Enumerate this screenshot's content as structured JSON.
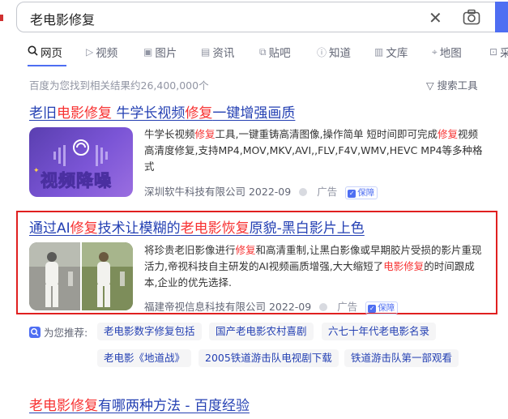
{
  "search": {
    "query": "老电影修复"
  },
  "tabs": [
    {
      "label": "网页",
      "icon": "search-icon"
    },
    {
      "label": "视频",
      "icon": "video-icon"
    },
    {
      "label": "图片",
      "icon": "image-icon"
    },
    {
      "label": "资讯",
      "icon": "news-icon"
    },
    {
      "label": "贴吧",
      "icon": "tieba-icon"
    },
    {
      "label": "知道",
      "icon": "question-icon"
    },
    {
      "label": "文库",
      "icon": "doc-icon"
    },
    {
      "label": "地图",
      "icon": "map-icon"
    },
    {
      "label": "采",
      "icon": "cart-icon"
    }
  ],
  "stats": "百度为您找到相关结果约26,400,000个",
  "tools": "搜索工具",
  "results": [
    {
      "title": [
        "老旧",
        "电影修复",
        " 牛学长视频",
        "修复",
        "一键增强画质"
      ],
      "thumb_text": "视频降噪",
      "snippet": [
        "牛学长视频",
        "修复",
        "工具,一键重铸高清图像,操作简单 短时间即可完成",
        "修复",
        "视频高清度修复,支持MP4,MOV,MKV,AVI,,FLV,F4V,WMV,HEVC MP4等多种格式"
      ],
      "source": "深圳软牛科技有限公司 2022-09",
      "ad": "广告",
      "badge": "保障"
    },
    {
      "title": [
        "通过AI",
        "修复",
        "技术让模糊的",
        "老电影恢复",
        "原貌-黑白影片上色"
      ],
      "snippet": [
        "将珍贵老旧影像进行",
        "修复",
        "和高清重制,让黑白影像或早期胶片受损的影片重现活力,帝视科技自主研发的AI视频画质增强,大大缩短了",
        "电影修复",
        "的时间跟成本,企业的优先选择."
      ],
      "source": "福建帝视信息科技有限公司 2022-09",
      "ad": "广告",
      "badge": "保障"
    },
    {
      "title": [
        "老电影修复",
        "有哪两种方法 - 百度经验"
      ]
    }
  ],
  "recommend": {
    "label": "为您推荐:",
    "chips": [
      "老电影数字修复包括",
      "国产老电影农村喜剧",
      "六七十年代老电影名录",
      "老电影《地道战》",
      "2005铁道游击队电视剧下载",
      "铁道游击队第一部观看"
    ]
  },
  "colors": {
    "link": "#2440b3",
    "highlight": "#f73131",
    "accent": "#4e6ef2",
    "border": "#e02020"
  }
}
